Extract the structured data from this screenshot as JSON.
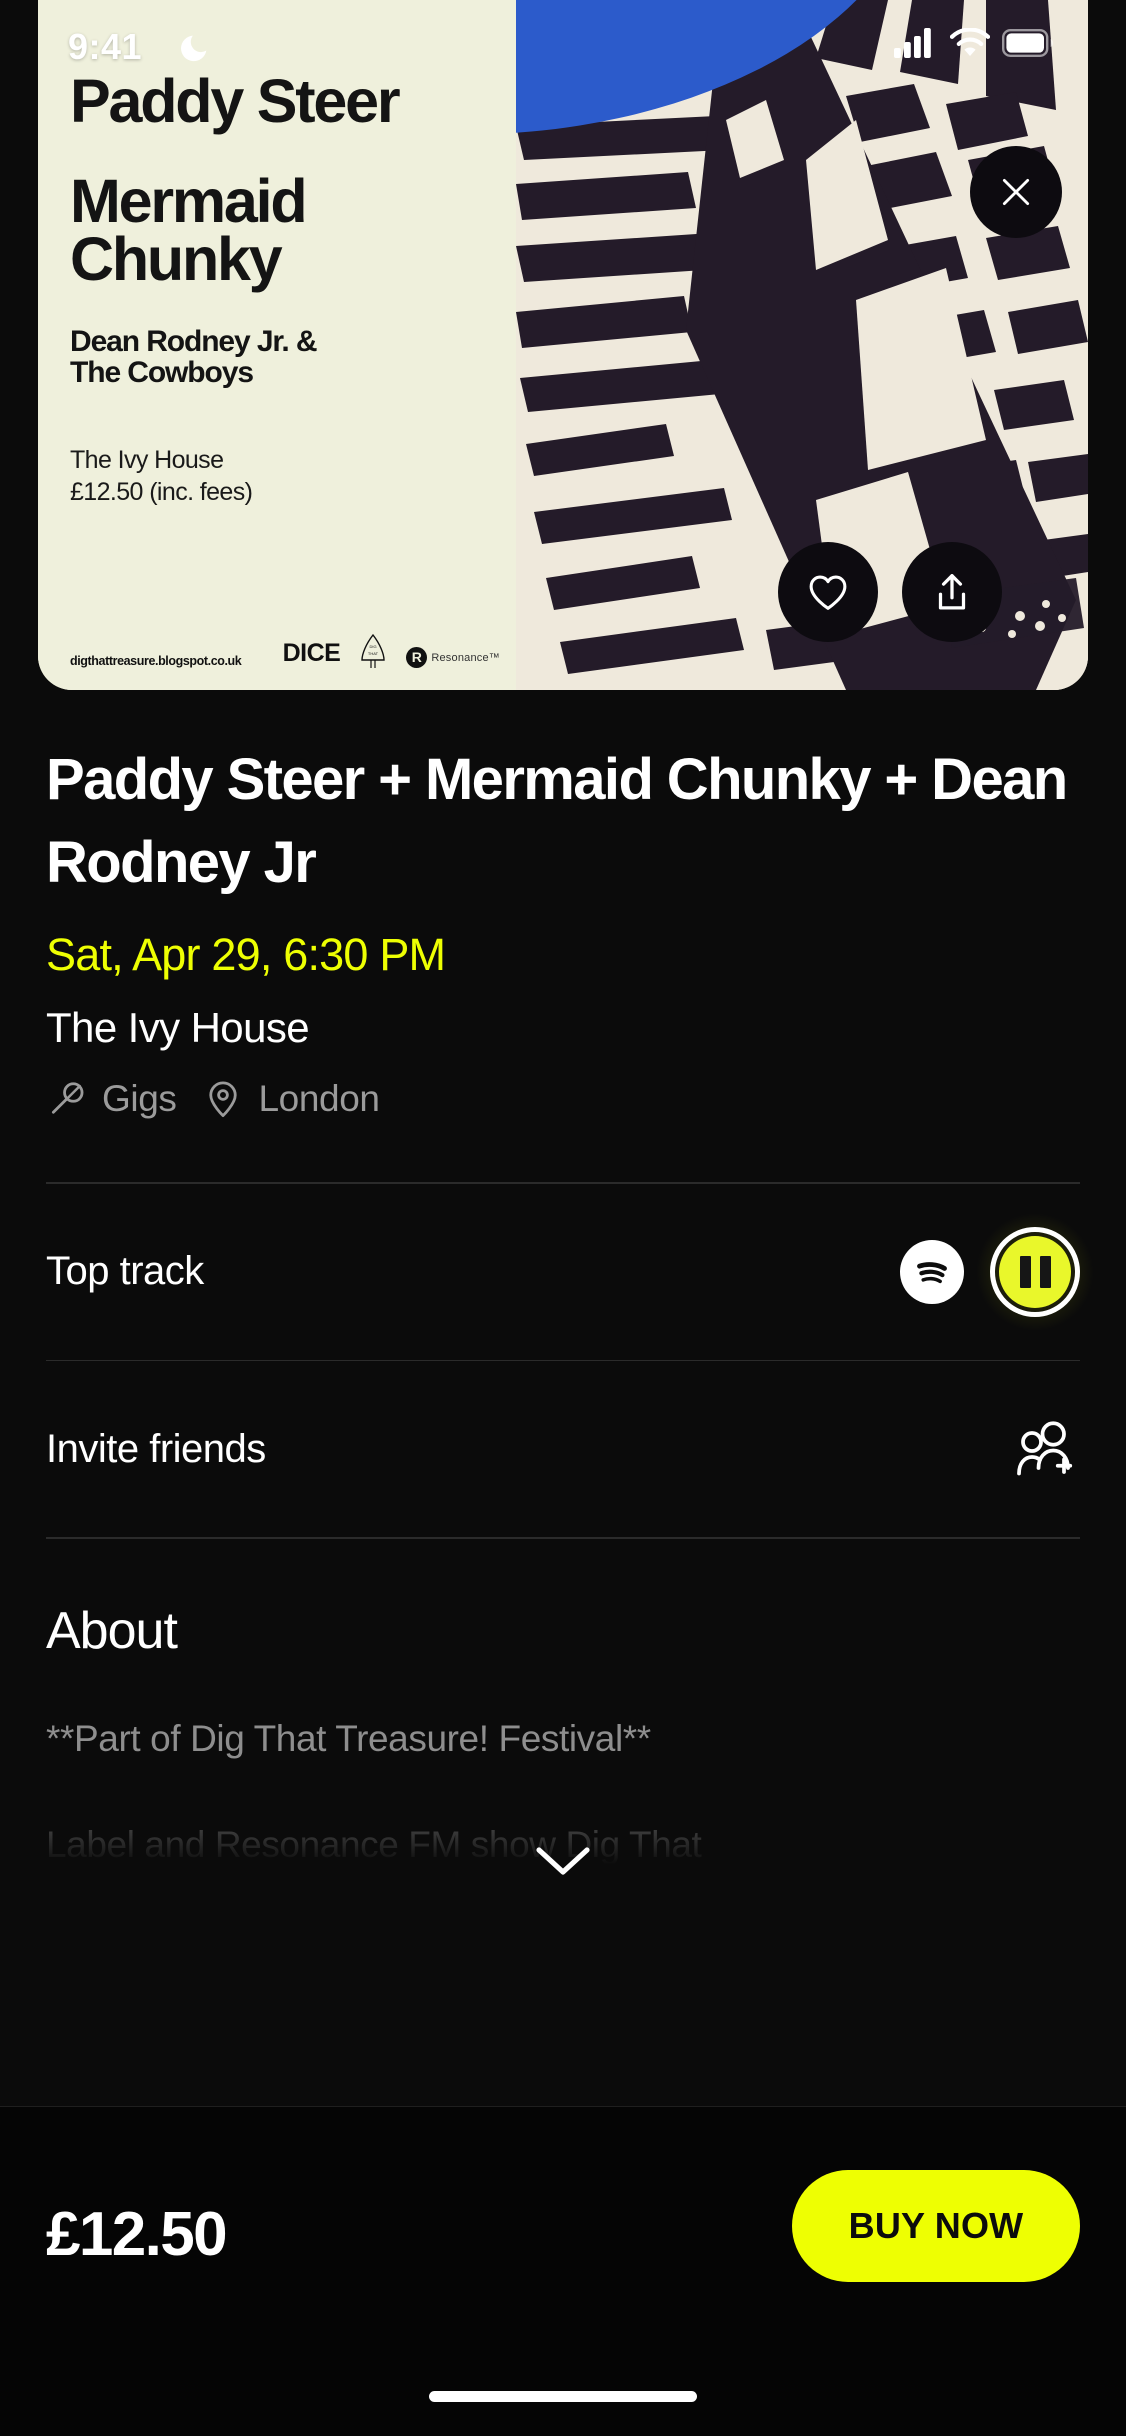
{
  "status_bar": {
    "time": "9:41",
    "dnd_icon": "moon-icon",
    "signal_icon": "cellular-signal-icon",
    "wifi_icon": "wifi-icon",
    "battery_icon": "battery-icon"
  },
  "poster": {
    "headline_1": "Paddy Steer",
    "headline_2a": "Mermaid",
    "headline_2b": "Chunky",
    "headline_3a": "Dean Rodney Jr. &",
    "headline_3b": "The Cowboys",
    "venue": "The Ivy House",
    "price": "£12.50 (inc. fees)",
    "footer_url": "digthattreasure.blogspot.co.uk",
    "logo_dice": "DICE",
    "logo_tree": "tree-icon",
    "logo_resonance_mark": "R",
    "logo_resonance_text": "Resonance™",
    "accent_blue": "#2C5BCB",
    "paper": "#EFF0DC"
  },
  "overlay_buttons": {
    "close": "close-icon",
    "favourite": "heart-icon",
    "share": "share-icon"
  },
  "event": {
    "title": "Paddy Steer + Mermaid Chunky + Dean Rodney Jr",
    "date": "Sat, Apr 29, 6:30 PM",
    "venue": "The Ivy House",
    "tags": [
      {
        "icon": "microphone-icon",
        "label": "Gigs"
      },
      {
        "icon": "location-pin-icon",
        "label": "London"
      }
    ]
  },
  "top_track": {
    "label": "Top track",
    "spotify_icon": "spotify-icon",
    "player_icon": "pause-icon",
    "player_state": "playing"
  },
  "invite": {
    "label": "Invite friends",
    "icon": "add-people-icon"
  },
  "about": {
    "heading": "About",
    "paragraph_1": "**Part of Dig That Treasure! Festival**",
    "paragraph_2": "Label and Resonance FM show Dig That",
    "expand_icon": "chevron-down-icon"
  },
  "bottom_bar": {
    "price": "£12.50",
    "buy_label": "BUY NOW",
    "buy_color": "#EEFF02"
  },
  "colors": {
    "accent_yellow": "#EEFF02",
    "background": "#0b0b0b",
    "muted_text": "#8e8e8e"
  }
}
